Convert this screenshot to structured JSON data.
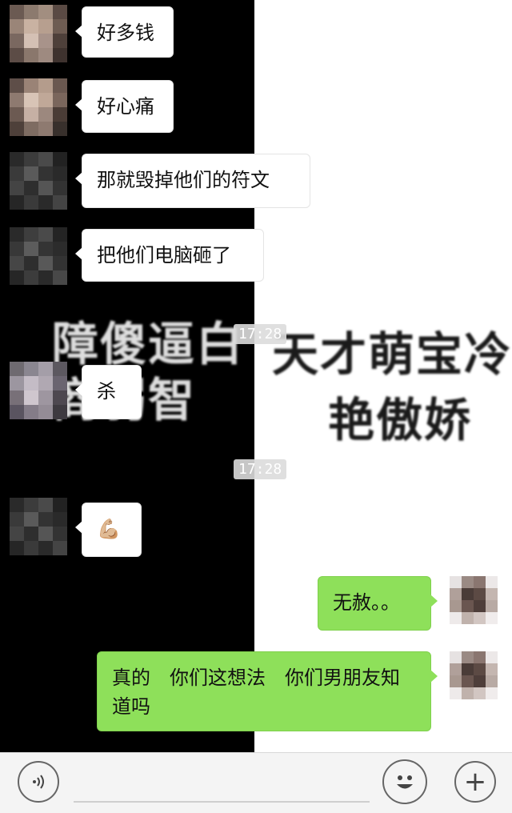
{
  "timestamps": [
    "17:28",
    "17:28"
  ],
  "background_text": {
    "left_line1": "障傻逼白",
    "left_line2": "商弱智",
    "right_line1": "天才萌宝冷",
    "right_line2": "艳傲娇"
  },
  "messages": [
    {
      "side": "left",
      "text": "好多钱"
    },
    {
      "side": "left",
      "text": "好心痛"
    },
    {
      "side": "left",
      "text": "那就毁掉他们的符文"
    },
    {
      "side": "left",
      "text": "把他们电脑砸了"
    },
    {
      "side": "left",
      "text": "杀"
    },
    {
      "side": "left",
      "text": "💪🏼"
    },
    {
      "side": "right",
      "text": "无赦。。"
    },
    {
      "side": "right",
      "text": "真的　你们这想法　你们男朋友知道吗"
    }
  ],
  "toolbar": {
    "voice_icon": "voice-icon",
    "emoji_icon": "smiley-icon",
    "plus_icon": "plus-icon",
    "plus_label": "+"
  }
}
